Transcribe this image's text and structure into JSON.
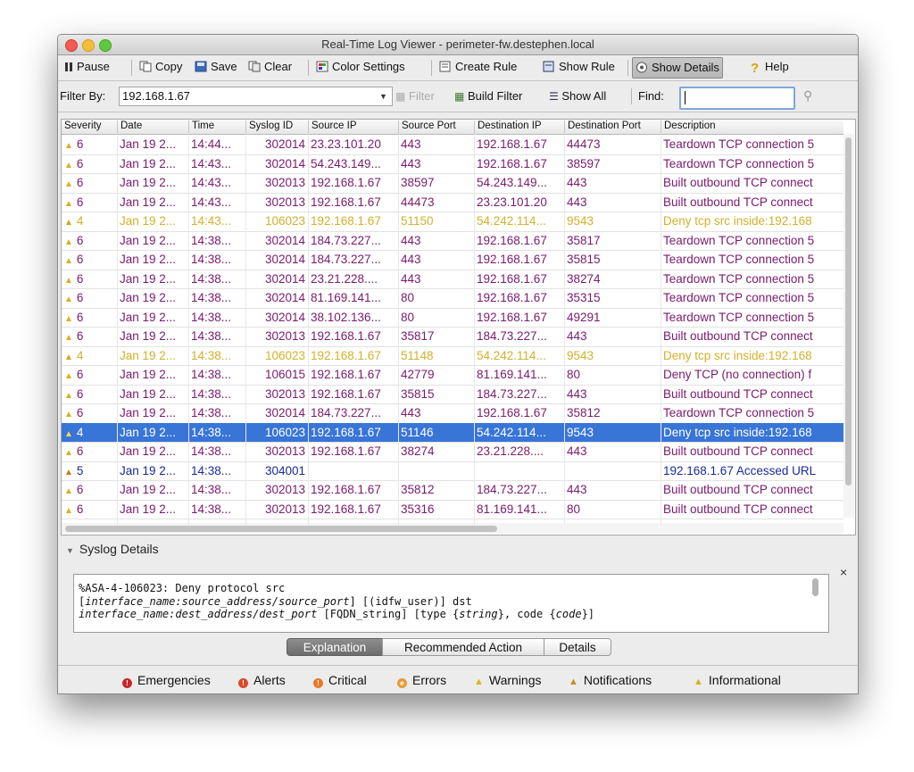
{
  "window": {
    "title": "Real-Time Log Viewer - perimeter-fw.destephen.local"
  },
  "toolbar": {
    "pause": "Pause",
    "copy": "Copy",
    "save": "Save",
    "clear": "Clear",
    "color_settings": "Color Settings",
    "create_rule": "Create Rule",
    "show_rule": "Show Rule",
    "show_details": "Show Details",
    "help": "Help"
  },
  "filterbar": {
    "filter_by_label": "Filter By:",
    "filter_value": "192.168.1.67",
    "filter_button": "Filter",
    "build_filter": "Build Filter",
    "show_all": "Show All",
    "find_label": "Find:",
    "find_value": ""
  },
  "table": {
    "columns": [
      "Severity",
      "Date",
      "Time",
      "Syslog ID",
      "Source IP",
      "Source Port",
      "Destination IP",
      "Destination Port",
      "Description"
    ],
    "rows": [
      {
        "sev": "6",
        "date": "Jan 19 2...",
        "time": "14:44...",
        "id": "302014",
        "src": "23.23.101.20",
        "sport": "443",
        "dst": "192.168.1.67",
        "dport": "44473",
        "desc": "Teardown TCP connection 5",
        "level": "info"
      },
      {
        "sev": "6",
        "date": "Jan 19 2...",
        "time": "14:43...",
        "id": "302014",
        "src": "54.243.149...",
        "sport": "443",
        "dst": "192.168.1.67",
        "dport": "38597",
        "desc": "Teardown TCP connection 5",
        "level": "info"
      },
      {
        "sev": "6",
        "date": "Jan 19 2...",
        "time": "14:43...",
        "id": "302013",
        "src": "192.168.1.67",
        "sport": "38597",
        "dst": "54.243.149...",
        "dport": "443",
        "desc": "Built outbound TCP connect",
        "level": "info"
      },
      {
        "sev": "6",
        "date": "Jan 19 2...",
        "time": "14:43...",
        "id": "302013",
        "src": "192.168.1.67",
        "sport": "44473",
        "dst": "23.23.101.20",
        "dport": "443",
        "desc": "Built outbound TCP connect",
        "level": "info"
      },
      {
        "sev": "4",
        "date": "Jan 19 2...",
        "time": "14:43...",
        "id": "106023",
        "src": "192.168.1.67",
        "sport": "51150",
        "dst": "54.242.114...",
        "dport": "9543",
        "desc": "Deny tcp src inside:192.168",
        "level": "warn"
      },
      {
        "sev": "6",
        "date": "Jan 19 2...",
        "time": "14:38...",
        "id": "302014",
        "src": "184.73.227...",
        "sport": "443",
        "dst": "192.168.1.67",
        "dport": "35817",
        "desc": "Teardown TCP connection 5",
        "level": "info"
      },
      {
        "sev": "6",
        "date": "Jan 19 2...",
        "time": "14:38...",
        "id": "302014",
        "src": "184.73.227...",
        "sport": "443",
        "dst": "192.168.1.67",
        "dport": "35815",
        "desc": "Teardown TCP connection 5",
        "level": "info"
      },
      {
        "sev": "6",
        "date": "Jan 19 2...",
        "time": "14:38...",
        "id": "302014",
        "src": "23.21.228....",
        "sport": "443",
        "dst": "192.168.1.67",
        "dport": "38274",
        "desc": "Teardown TCP connection 5",
        "level": "info"
      },
      {
        "sev": "6",
        "date": "Jan 19 2...",
        "time": "14:38...",
        "id": "302014",
        "src": "81.169.141...",
        "sport": "80",
        "dst": "192.168.1.67",
        "dport": "35315",
        "desc": "Teardown TCP connection 5",
        "level": "info"
      },
      {
        "sev": "6",
        "date": "Jan 19 2...",
        "time": "14:38...",
        "id": "302014",
        "src": "38.102.136...",
        "sport": "80",
        "dst": "192.168.1.67",
        "dport": "49291",
        "desc": "Teardown TCP connection 5",
        "level": "info"
      },
      {
        "sev": "6",
        "date": "Jan 19 2...",
        "time": "14:38...",
        "id": "302013",
        "src": "192.168.1.67",
        "sport": "35817",
        "dst": "184.73.227...",
        "dport": "443",
        "desc": "Built outbound TCP connect",
        "level": "info"
      },
      {
        "sev": "4",
        "date": "Jan 19 2...",
        "time": "14:38...",
        "id": "106023",
        "src": "192.168.1.67",
        "sport": "51148",
        "dst": "54.242.114...",
        "dport": "9543",
        "desc": "Deny tcp src inside:192.168",
        "level": "warn"
      },
      {
        "sev": "6",
        "date": "Jan 19 2...",
        "time": "14:38...",
        "id": "106015",
        "src": "192.168.1.67",
        "sport": "42779",
        "dst": "81.169.141...",
        "dport": "80",
        "desc": "Deny TCP (no connection) f",
        "level": "info"
      },
      {
        "sev": "6",
        "date": "Jan 19 2...",
        "time": "14:38...",
        "id": "302013",
        "src": "192.168.1.67",
        "sport": "35815",
        "dst": "184.73.227...",
        "dport": "443",
        "desc": "Built outbound TCP connect",
        "level": "info"
      },
      {
        "sev": "6",
        "date": "Jan 19 2...",
        "time": "14:38...",
        "id": "302014",
        "src": "184.73.227...",
        "sport": "443",
        "dst": "192.168.1.67",
        "dport": "35812",
        "desc": "Teardown TCP connection 5",
        "level": "info"
      },
      {
        "sev": "4",
        "date": "Jan 19 2...",
        "time": "14:38...",
        "id": "106023",
        "src": "192.168.1.67",
        "sport": "51146",
        "dst": "54.242.114...",
        "dport": "9543",
        "desc": "Deny tcp src inside:192.168",
        "level": "sel"
      },
      {
        "sev": "6",
        "date": "Jan 19 2...",
        "time": "14:38...",
        "id": "302013",
        "src": "192.168.1.67",
        "sport": "38274",
        "dst": "23.21.228....",
        "dport": "443",
        "desc": "Built outbound TCP connect",
        "level": "info"
      },
      {
        "sev": "5",
        "date": "Jan 19 2...",
        "time": "14:38...",
        "id": "304001",
        "src": "",
        "sport": "",
        "dst": "",
        "dport": "",
        "desc": "192.168.1.67 Accessed URL",
        "level": "notice"
      },
      {
        "sev": "6",
        "date": "Jan 19 2...",
        "time": "14:38...",
        "id": "302013",
        "src": "192.168.1.67",
        "sport": "35812",
        "dst": "184.73.227...",
        "dport": "443",
        "desc": "Built outbound TCP connect",
        "level": "info"
      },
      {
        "sev": "6",
        "date": "Jan 19 2...",
        "time": "14:38...",
        "id": "302013",
        "src": "192.168.1.67",
        "sport": "35316",
        "dst": "81.169.141...",
        "dport": "80",
        "desc": "Built outbound TCP connect",
        "level": "info"
      }
    ]
  },
  "details": {
    "header": "Syslog Details",
    "line1": "%ASA-4-106023: Deny protocol src",
    "line2_a": "[",
    "line2_b": "interface_name:source_address/source_port",
    "line2_c": "] [(idfw_user)] dst",
    "line3_a": "interface_name:dest_address/dest_port",
    "line3_b": " [FQDN_string] [type {",
    "line3_c": "string",
    "line3_d": "}, code {",
    "line3_e": "code",
    "line3_f": "}]",
    "tabs": [
      "Explanation",
      "Recommended Action",
      "Details"
    ]
  },
  "legend": [
    "Emergencies",
    "Alerts",
    "Critical",
    "Errors",
    "Warnings",
    "Notifications",
    "Informational"
  ],
  "colors": {
    "info": "#7a1a6e",
    "warn": "#d2b12a",
    "notice": "#1a2a9a",
    "selected": "#3875d7"
  }
}
